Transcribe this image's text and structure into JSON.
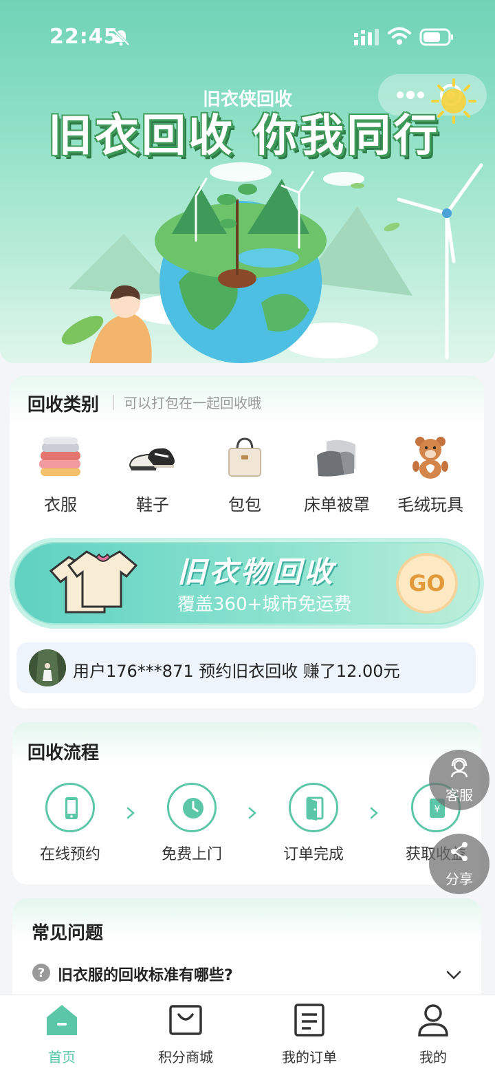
{
  "status_bar": {
    "time": "22:45"
  },
  "banner": {
    "subtitle": "旧衣侠回收",
    "title": "旧衣回收 你我同行"
  },
  "categories": {
    "title": "回收类别",
    "subtitle": "可以打包在一起回收哦",
    "items": [
      {
        "label": "衣服",
        "icon": "clothes-icon"
      },
      {
        "label": "鞋子",
        "icon": "shoes-icon"
      },
      {
        "label": "包包",
        "icon": "bag-icon"
      },
      {
        "label": "床单被罩",
        "icon": "bedding-icon"
      },
      {
        "label": "毛绒玩具",
        "icon": "plush-toy-icon"
      }
    ]
  },
  "recycle_banner": {
    "title": "旧衣物回收",
    "subtitle": "覆盖360+城市免运费",
    "go_label": "GO"
  },
  "notice": {
    "text": "用户176***871 预约旧衣回收 赚了12.00元"
  },
  "flow": {
    "title": "回收流程",
    "steps": [
      {
        "label": "在线预约",
        "icon": "phone-icon"
      },
      {
        "label": "免费上门",
        "icon": "clock-icon"
      },
      {
        "label": "订单完成",
        "icon": "door-icon"
      },
      {
        "label": "获取收益",
        "icon": "wallet-icon"
      }
    ]
  },
  "faq": {
    "title": "常见问题",
    "question": "旧衣服的回收标准有哪些?"
  },
  "floating": {
    "service_label": "客服",
    "share_label": "分享"
  },
  "bottom_nav": {
    "items": [
      {
        "label": "首页",
        "icon": "home-icon",
        "active": true
      },
      {
        "label": "积分商城",
        "icon": "shop-bag-icon",
        "active": false
      },
      {
        "label": "我的订单",
        "icon": "order-list-icon",
        "active": false
      },
      {
        "label": "我的",
        "icon": "profile-icon",
        "active": false
      }
    ]
  },
  "colors": {
    "accent": "#5cc7a8",
    "hero_top": "#6fd3b6",
    "go_text": "#e39a3a"
  }
}
